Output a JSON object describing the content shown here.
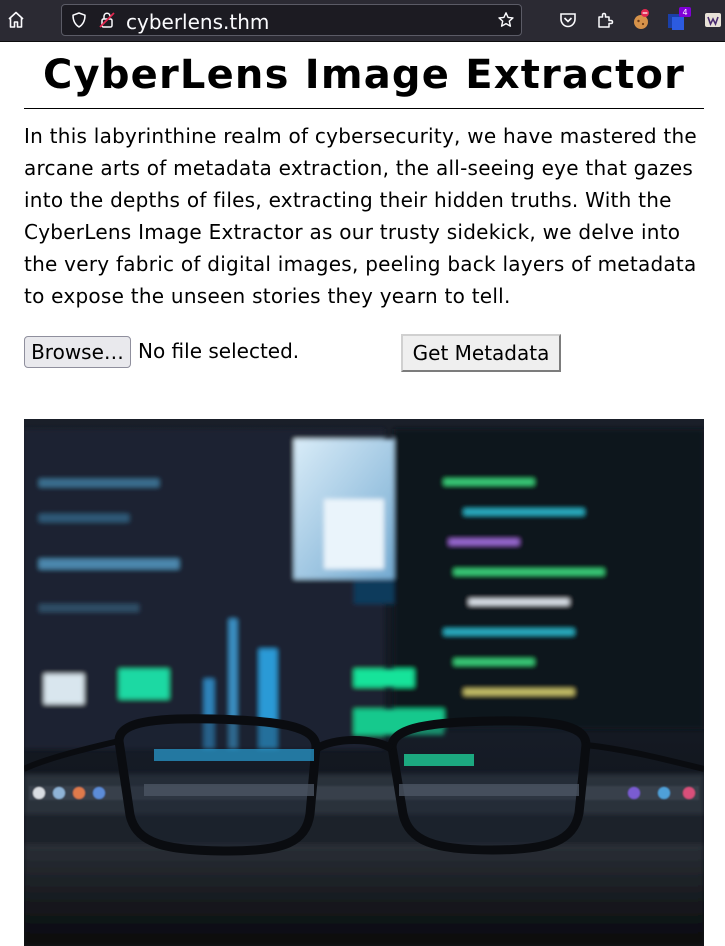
{
  "browser": {
    "url": "cyberlens.thm",
    "extension_badge": "4"
  },
  "page": {
    "title": "CyberLens Image Extractor",
    "intro": "In this labyrinthine realm of cybersecurity, we have mastered the arcane arts of metadata extraction, the all-seeing eye that gazes into the depths of files, extracting their hidden truths. With the CyberLens Image Extractor as our trusty sidekick, we delve into the very fabric of digital images, peeling back layers of metadata to expose the unseen stories they yearn to tell."
  },
  "form": {
    "browse_label": "Browse…",
    "file_status": "No file selected.",
    "submit_label": "Get Metadata"
  },
  "icons": {
    "home": "home-icon",
    "shield": "tracking-protection-icon",
    "lock": "insecure-lock-icon",
    "star": "bookmark-star-icon",
    "pocket": "pocket-icon",
    "extensions": "extensions-puzzle-icon"
  },
  "colors": {
    "toolbar": "#2b2a33",
    "urlbar": "#1c1b22",
    "lock_warning": "#e22850",
    "badge": "#8000d7"
  }
}
